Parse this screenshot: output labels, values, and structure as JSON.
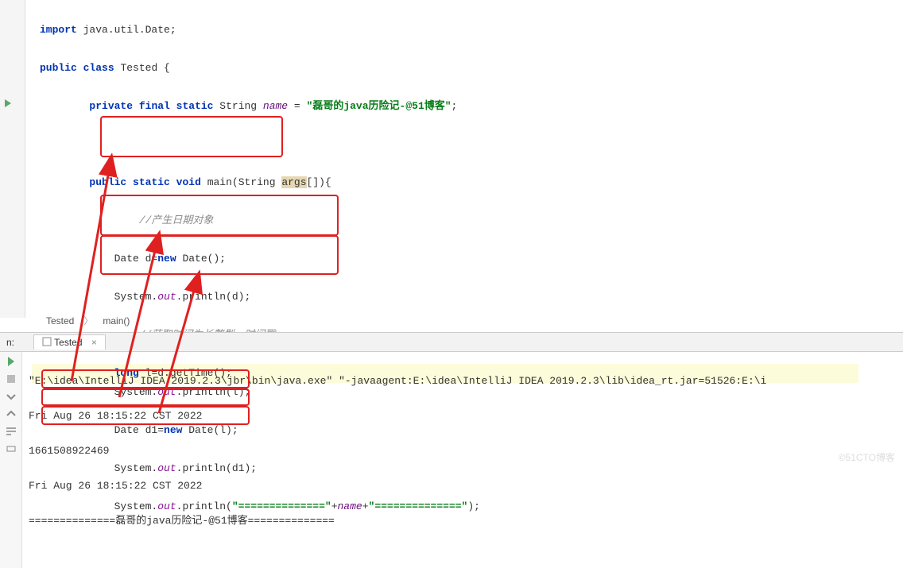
{
  "code": {
    "import_kw": "import",
    "import_pkg": " java.util.Date;",
    "public": "public",
    "class": "class",
    "class_name": " Tested {",
    "private": "private",
    "final": "final",
    "static": "static",
    "string_type": " String ",
    "name_var": "name",
    "assign": " = ",
    "string_val": "\"磊哥的java历险记-@51博客\"",
    "semi": ";",
    "void": "void",
    "main_sig": " main(String ",
    "args": "args",
    "main_end": "[]){",
    "comment1": "//产生日期对象",
    "date_decl": "Date d=",
    "new": "new",
    "date_ctor": " Date();",
    "sysout": "System.",
    "out": "out",
    "println_d": ".println(d);",
    "comment2": "//获取时间为长整型，时间戳",
    "long": "long",
    "gettime": " l=d.getTime();",
    "println_l": ".println(l);",
    "date_d1": "Date d1=",
    "date_ctor_l": " Date(l);",
    "println_d1": ".println(d1);",
    "println_eq1": ".println(",
    "eq_str1": "\"==============\"",
    "plus": "+",
    "eq_str2": "\"==============\"",
    "close_paren": ");"
  },
  "breadcrumb": {
    "item1": "Tested",
    "item2": "main()"
  },
  "run": {
    "label": "n:",
    "tab": "Tested",
    "cmd": "\"E:\\idea\\IntelliJ IDEA 2019.2.3\\jbr\\bin\\java.exe\" \"-javaagent:E:\\idea\\IntelliJ IDEA 2019.2.3\\lib\\idea_rt.jar=51526:E:\\i",
    "out1": "Fri Aug 26 18:15:22 CST 2022",
    "out2": "1661508922469",
    "out3": "Fri Aug 26 18:15:22 CST 2022",
    "out4": "==============磊哥的java历险记-@51博客=============="
  },
  "watermark": "©51CTO博客"
}
